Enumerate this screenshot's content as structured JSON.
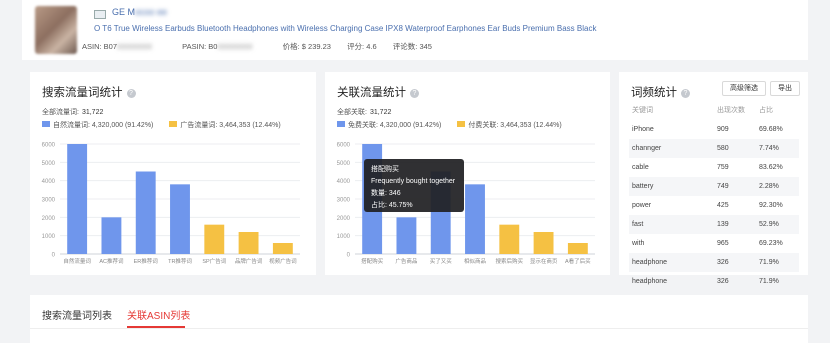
{
  "product": {
    "brand": "GE M",
    "title": "O T6 True Wireless Earbuds Bluetooth Headphones with Wireless Charging Case IPX8 Waterproof Earphones Ear Buds Premium Bass Black",
    "asin_label": "ASIN: B07",
    "pasin_label": "PASIN: B0",
    "price_label": "价格:",
    "price": "$ 239.23",
    "rating_label": "评分:",
    "rating": "4.6",
    "reviews_label": "评论数:",
    "reviews": "345"
  },
  "search_panel": {
    "title": "搜索流量词统计",
    "total_label": "全部流量词:",
    "total": "31,722",
    "legend": [
      {
        "label": "自然流量词: 4,320,000 (91.42%)",
        "color": "#6f96ec"
      },
      {
        "label": "广告流量词: 3,464,353 (12.44%)",
        "color": "#f5c143"
      }
    ]
  },
  "related_panel": {
    "title": "关联流量统计",
    "total_label": "全部关联:",
    "total": "31,722",
    "legend": [
      {
        "label": "免费关联: 4,320,000 (91.42%)",
        "color": "#6f96ec"
      },
      {
        "label": "付费关联: 3,464,353 (12.44%)",
        "color": "#f5c143"
      }
    ]
  },
  "tooltip": {
    "title": "搭配购买",
    "subtitle": "Frequently bought together",
    "count_label": "数量:",
    "count": "346",
    "ratio_label": "占比:",
    "ratio": "45.75%"
  },
  "wordfreq": {
    "title": "词频统计",
    "filter_button": "高级筛选",
    "export_button": "导出",
    "columns": [
      "关键词",
      "出现次数",
      "占比"
    ],
    "rows": [
      [
        "iPhone",
        "909",
        "69.68%"
      ],
      [
        "channger",
        "580",
        "7.74%"
      ],
      [
        "cable",
        "759",
        "83.62%"
      ],
      [
        "battery",
        "749",
        "2.28%"
      ],
      [
        "power",
        "425",
        "92.30%"
      ],
      [
        "fast",
        "139",
        "52.9%"
      ],
      [
        "with",
        "965",
        "69.23%"
      ],
      [
        "headphone",
        "326",
        "71.9%"
      ],
      [
        "headphone",
        "326",
        "71.9%"
      ]
    ]
  },
  "tabs": [
    {
      "label": "搜索流量词列表",
      "active": false
    },
    {
      "label": "关联ASIN列表",
      "active": true
    }
  ],
  "chart_data": [
    {
      "type": "bar",
      "categories": [
        "自然流量词",
        "AC推荐词",
        "ER推荐词",
        "TR推荐词",
        "SP广告词",
        "品牌广告词",
        "视频广告词"
      ],
      "values": [
        6000,
        2000,
        4500,
        3800,
        1600,
        1200,
        600
      ],
      "colors": [
        "#6f96ec",
        "#6f96ec",
        "#6f96ec",
        "#6f96ec",
        "#f5c143",
        "#f5c143",
        "#f5c143"
      ],
      "yticks": [
        0,
        1000,
        2000,
        3000,
        4000,
        5000,
        6000
      ],
      "ylim": [
        0,
        6000
      ],
      "grid": true
    },
    {
      "type": "bar",
      "categories": [
        "搭配购买",
        "广告商品",
        "买了又买",
        "相似商品",
        "搜索后购买",
        "显示在商页",
        "A看了后买"
      ],
      "values": [
        6000,
        2000,
        4500,
        3800,
        1600,
        1200,
        600
      ],
      "colors": [
        "#6f96ec",
        "#6f96ec",
        "#6f96ec",
        "#6f96ec",
        "#f5c143",
        "#f5c143",
        "#f5c143"
      ],
      "yticks": [
        0,
        1000,
        2000,
        3000,
        4000,
        5000,
        6000
      ],
      "ylim": [
        0,
        6000
      ],
      "grid": true
    }
  ]
}
